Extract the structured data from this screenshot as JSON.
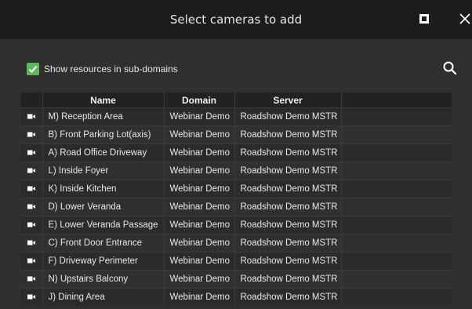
{
  "dialog": {
    "title": "Select cameras to add",
    "maximize_icon": "maximize-icon",
    "close_icon": "close-icon"
  },
  "filter": {
    "show_subdomains_label": "Show resources in sub-domains",
    "show_subdomains_checked": true,
    "checkbox_color": "#5cb85c",
    "search_icon": "search-icon"
  },
  "table": {
    "columns": [
      "",
      "Name",
      "Domain",
      "Server",
      ""
    ],
    "rows": [
      {
        "icon": "camera-icon",
        "name": "M) Reception Area",
        "domain": "Webinar Demo",
        "server": "Roadshow Demo MSTR"
      },
      {
        "icon": "camera-icon",
        "name": "B) Front Parking Lot(axis)",
        "domain": "Webinar Demo",
        "server": "Roadshow Demo MSTR"
      },
      {
        "icon": "camera-icon",
        "name": "A) Road Office Driveway",
        "domain": "Webinar Demo",
        "server": "Roadshow Demo MSTR"
      },
      {
        "icon": "camera-icon",
        "name": "L) Inside Foyer",
        "domain": "Webinar Demo",
        "server": "Roadshow Demo MSTR"
      },
      {
        "icon": "camera-icon",
        "name": "K) Inside Kitchen",
        "domain": "Webinar Demo",
        "server": "Roadshow Demo MSTR"
      },
      {
        "icon": "camera-icon",
        "name": "D) Lower Veranda",
        "domain": "Webinar Demo",
        "server": "Roadshow Demo MSTR"
      },
      {
        "icon": "camera-icon",
        "name": "E) Lower Veranda Passage",
        "domain": "Webinar Demo",
        "server": "Roadshow Demo MSTR"
      },
      {
        "icon": "camera-icon",
        "name": "C) Front Door Entrance",
        "domain": "Webinar Demo",
        "server": "Roadshow Demo MSTR"
      },
      {
        "icon": "camera-icon",
        "name": "F) Driveway Perimeter",
        "domain": "Webinar Demo",
        "server": "Roadshow Demo MSTR"
      },
      {
        "icon": "camera-icon",
        "name": "N) Upstairs Balcony",
        "domain": "Webinar Demo",
        "server": "Roadshow Demo MSTR"
      },
      {
        "icon": "camera-icon",
        "name": "J) Dining Area",
        "domain": "Webinar Demo",
        "server": "Roadshow Demo MSTR"
      }
    ]
  },
  "colors": {
    "titlebar_bg": "#1c1c1c",
    "dialog_bg": "#2f2f2f",
    "header_bg": "#222222"
  }
}
